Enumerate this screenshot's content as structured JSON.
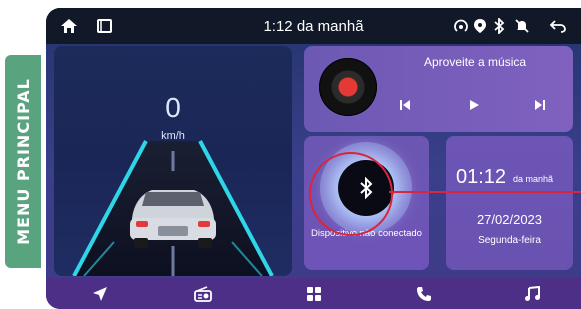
{
  "side_label": "MENU PRINCIPAL",
  "statusbar": {
    "time": "1:12 da manhã"
  },
  "speed": {
    "value": "0",
    "unit": "km/h"
  },
  "music": {
    "title": "Aproveite a música"
  },
  "bluetooth": {
    "status": "Dispositivo não conectado"
  },
  "clock": {
    "time": "01:12",
    "suffix": "da manhã",
    "date": "27/02/2023",
    "day": "Segunda-feira"
  },
  "colors": {
    "accent_red": "#d7263d",
    "side_label_bg": "#5aa37f",
    "nav_bg": "#4d2f87",
    "tile_purple": "#6d55b6"
  },
  "icons": {
    "status_left": [
      "home-icon",
      "recent-apps-icon"
    ],
    "status_right": [
      "hotspot-icon",
      "location-icon",
      "bluetooth-icon",
      "mute-icon",
      "back-icon"
    ],
    "nav": [
      "navigation-icon",
      "radio-icon",
      "apps-grid-icon",
      "phone-icon",
      "music-icon"
    ]
  }
}
